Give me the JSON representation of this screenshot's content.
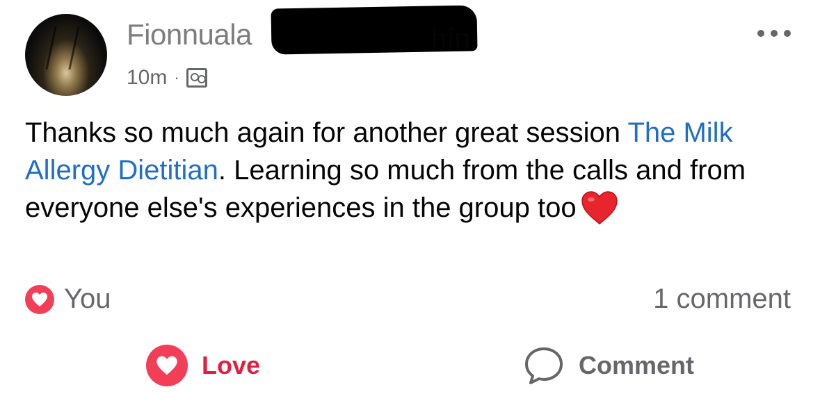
{
  "post": {
    "author_visible": "Fionnuala",
    "author_suffix": "hín",
    "time": "10m",
    "separator": "·",
    "privacy_icon": "group-icon",
    "text_before_link": "Thanks so much again for another great session ",
    "link_text": "The Milk Allergy Dietitian",
    "text_after_link": ". Learning so much from the calls and from everyone else's experiences in the group too",
    "emoji": "red-heart-emoji"
  },
  "reactions": {
    "icon": "heart-icon",
    "label": "You",
    "comments": "1 comment"
  },
  "actions": {
    "love_label": "Love",
    "comment_label": "Comment"
  },
  "colors": {
    "link": "#1f6ecb",
    "love": "#e41e3f",
    "heart_badge": "#f33e58",
    "muted": "#65676b"
  }
}
